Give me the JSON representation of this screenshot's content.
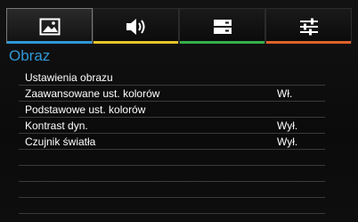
{
  "colors": {
    "accent_title": "#2f97d6",
    "tab_picture": "#2f97d6",
    "tab_audio": "#e6c42c",
    "tab_display": "#35b04a",
    "tab_settings": "#e0622a"
  },
  "tabs": [
    {
      "icon": "picture-icon"
    },
    {
      "icon": "speaker-icon"
    },
    {
      "icon": "display-settings-icon"
    },
    {
      "icon": "sliders-icon"
    }
  ],
  "section_title": "Obraz",
  "menu": {
    "items": [
      {
        "label": "Ustawienia obrazu",
        "value": ""
      },
      {
        "label": "Zaawansowane ust. kolorów",
        "value": "Wł."
      },
      {
        "label": "Podstawowe ust. kolorów",
        "value": ""
      },
      {
        "label": "Kontrast dyn.",
        "value": "Wył."
      },
      {
        "label": "Czujnik światła",
        "value": "Wył."
      },
      {
        "label": "",
        "value": ""
      },
      {
        "label": "",
        "value": ""
      },
      {
        "label": "",
        "value": ""
      },
      {
        "label": "",
        "value": ""
      }
    ]
  }
}
